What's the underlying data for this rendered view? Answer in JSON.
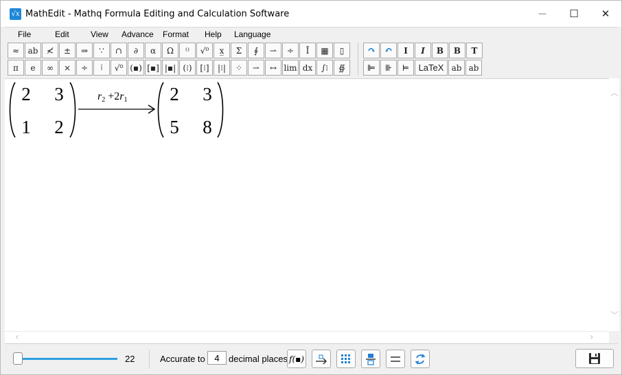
{
  "window": {
    "title": "MathEdit - Mathq Formula Editing and Calculation Software",
    "app_icon_glyph": "√x",
    "controls": {
      "minimize": "—",
      "maximize": "☐",
      "close": "✕"
    }
  },
  "menu": [
    "File",
    "Edit",
    "View",
    "Advance",
    "Format",
    "Help",
    "Language"
  ],
  "toolbar": {
    "row1": [
      "≈",
      "ab",
      "≮",
      "±",
      "⇒",
      "∵",
      "∩",
      "∂",
      "α",
      "Ω",
      "⁽⁾",
      "√⁰",
      "x̲",
      "Σ",
      "∮",
      "⇀",
      "÷",
      "Ī",
      "▦",
      "▯"
    ],
    "row2": [
      "π",
      "e",
      "∞",
      "×",
      "÷",
      "⁞",
      "√⁰",
      "(▪)",
      "[▪]",
      "|▪|",
      "(⁝)",
      "[⁝]",
      "|⁝|",
      "⁘",
      "⇀",
      "↔",
      "lim",
      "dx",
      "∫⁝",
      "∯"
    ],
    "format_row1": [
      "↷",
      "↶",
      "I",
      "I",
      "B",
      "B",
      "T"
    ],
    "format_row2": [
      "⊫",
      "⊪",
      "⊨",
      "LaTeX",
      "ab",
      "ab"
    ]
  },
  "formula": {
    "matrix_left": [
      [
        "2",
        "3"
      ],
      [
        "1",
        "2"
      ]
    ],
    "arrow_label": {
      "base1": "r",
      "sub1": "2",
      "op": "+2",
      "base2": "r",
      "sub2": "1"
    },
    "matrix_right": [
      [
        "2",
        "3"
      ],
      [
        "5",
        "8"
      ]
    ]
  },
  "status": {
    "zoom_value": "22",
    "accuracy_prefix": "Accurate to",
    "accuracy_value": "4",
    "accuracy_suffix": "decimal places",
    "fx_label": "f(▪)"
  },
  "colors": {
    "accent": "#1f7fd6",
    "slider": "#2b9fe0",
    "icon_blue": "#1e88d8"
  }
}
